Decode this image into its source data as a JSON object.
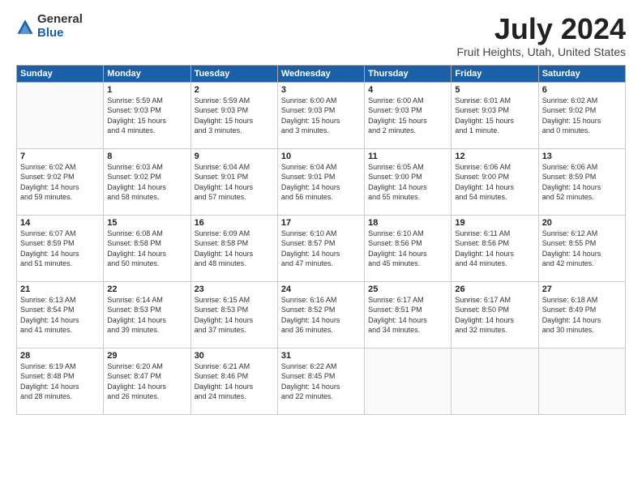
{
  "logo": {
    "general": "General",
    "blue": "Blue"
  },
  "title": "July 2024",
  "location": "Fruit Heights, Utah, United States",
  "days_of_week": [
    "Sunday",
    "Monday",
    "Tuesday",
    "Wednesday",
    "Thursday",
    "Friday",
    "Saturday"
  ],
  "weeks": [
    [
      {
        "day": "",
        "info": ""
      },
      {
        "day": "1",
        "info": "Sunrise: 5:59 AM\nSunset: 9:03 PM\nDaylight: 15 hours\nand 4 minutes."
      },
      {
        "day": "2",
        "info": "Sunrise: 5:59 AM\nSunset: 9:03 PM\nDaylight: 15 hours\nand 3 minutes."
      },
      {
        "day": "3",
        "info": "Sunrise: 6:00 AM\nSunset: 9:03 PM\nDaylight: 15 hours\nand 3 minutes."
      },
      {
        "day": "4",
        "info": "Sunrise: 6:00 AM\nSunset: 9:03 PM\nDaylight: 15 hours\nand 2 minutes."
      },
      {
        "day": "5",
        "info": "Sunrise: 6:01 AM\nSunset: 9:03 PM\nDaylight: 15 hours\nand 1 minute."
      },
      {
        "day": "6",
        "info": "Sunrise: 6:02 AM\nSunset: 9:02 PM\nDaylight: 15 hours\nand 0 minutes."
      }
    ],
    [
      {
        "day": "7",
        "info": "Sunrise: 6:02 AM\nSunset: 9:02 PM\nDaylight: 14 hours\nand 59 minutes."
      },
      {
        "day": "8",
        "info": "Sunrise: 6:03 AM\nSunset: 9:02 PM\nDaylight: 14 hours\nand 58 minutes."
      },
      {
        "day": "9",
        "info": "Sunrise: 6:04 AM\nSunset: 9:01 PM\nDaylight: 14 hours\nand 57 minutes."
      },
      {
        "day": "10",
        "info": "Sunrise: 6:04 AM\nSunset: 9:01 PM\nDaylight: 14 hours\nand 56 minutes."
      },
      {
        "day": "11",
        "info": "Sunrise: 6:05 AM\nSunset: 9:00 PM\nDaylight: 14 hours\nand 55 minutes."
      },
      {
        "day": "12",
        "info": "Sunrise: 6:06 AM\nSunset: 9:00 PM\nDaylight: 14 hours\nand 54 minutes."
      },
      {
        "day": "13",
        "info": "Sunrise: 6:06 AM\nSunset: 8:59 PM\nDaylight: 14 hours\nand 52 minutes."
      }
    ],
    [
      {
        "day": "14",
        "info": "Sunrise: 6:07 AM\nSunset: 8:59 PM\nDaylight: 14 hours\nand 51 minutes."
      },
      {
        "day": "15",
        "info": "Sunrise: 6:08 AM\nSunset: 8:58 PM\nDaylight: 14 hours\nand 50 minutes."
      },
      {
        "day": "16",
        "info": "Sunrise: 6:09 AM\nSunset: 8:58 PM\nDaylight: 14 hours\nand 48 minutes."
      },
      {
        "day": "17",
        "info": "Sunrise: 6:10 AM\nSunset: 8:57 PM\nDaylight: 14 hours\nand 47 minutes."
      },
      {
        "day": "18",
        "info": "Sunrise: 6:10 AM\nSunset: 8:56 PM\nDaylight: 14 hours\nand 45 minutes."
      },
      {
        "day": "19",
        "info": "Sunrise: 6:11 AM\nSunset: 8:56 PM\nDaylight: 14 hours\nand 44 minutes."
      },
      {
        "day": "20",
        "info": "Sunrise: 6:12 AM\nSunset: 8:55 PM\nDaylight: 14 hours\nand 42 minutes."
      }
    ],
    [
      {
        "day": "21",
        "info": "Sunrise: 6:13 AM\nSunset: 8:54 PM\nDaylight: 14 hours\nand 41 minutes."
      },
      {
        "day": "22",
        "info": "Sunrise: 6:14 AM\nSunset: 8:53 PM\nDaylight: 14 hours\nand 39 minutes."
      },
      {
        "day": "23",
        "info": "Sunrise: 6:15 AM\nSunset: 8:53 PM\nDaylight: 14 hours\nand 37 minutes."
      },
      {
        "day": "24",
        "info": "Sunrise: 6:16 AM\nSunset: 8:52 PM\nDaylight: 14 hours\nand 36 minutes."
      },
      {
        "day": "25",
        "info": "Sunrise: 6:17 AM\nSunset: 8:51 PM\nDaylight: 14 hours\nand 34 minutes."
      },
      {
        "day": "26",
        "info": "Sunrise: 6:17 AM\nSunset: 8:50 PM\nDaylight: 14 hours\nand 32 minutes."
      },
      {
        "day": "27",
        "info": "Sunrise: 6:18 AM\nSunset: 8:49 PM\nDaylight: 14 hours\nand 30 minutes."
      }
    ],
    [
      {
        "day": "28",
        "info": "Sunrise: 6:19 AM\nSunset: 8:48 PM\nDaylight: 14 hours\nand 28 minutes."
      },
      {
        "day": "29",
        "info": "Sunrise: 6:20 AM\nSunset: 8:47 PM\nDaylight: 14 hours\nand 26 minutes."
      },
      {
        "day": "30",
        "info": "Sunrise: 6:21 AM\nSunset: 8:46 PM\nDaylight: 14 hours\nand 24 minutes."
      },
      {
        "day": "31",
        "info": "Sunrise: 6:22 AM\nSunset: 8:45 PM\nDaylight: 14 hours\nand 22 minutes."
      },
      {
        "day": "",
        "info": ""
      },
      {
        "day": "",
        "info": ""
      },
      {
        "day": "",
        "info": ""
      }
    ]
  ]
}
